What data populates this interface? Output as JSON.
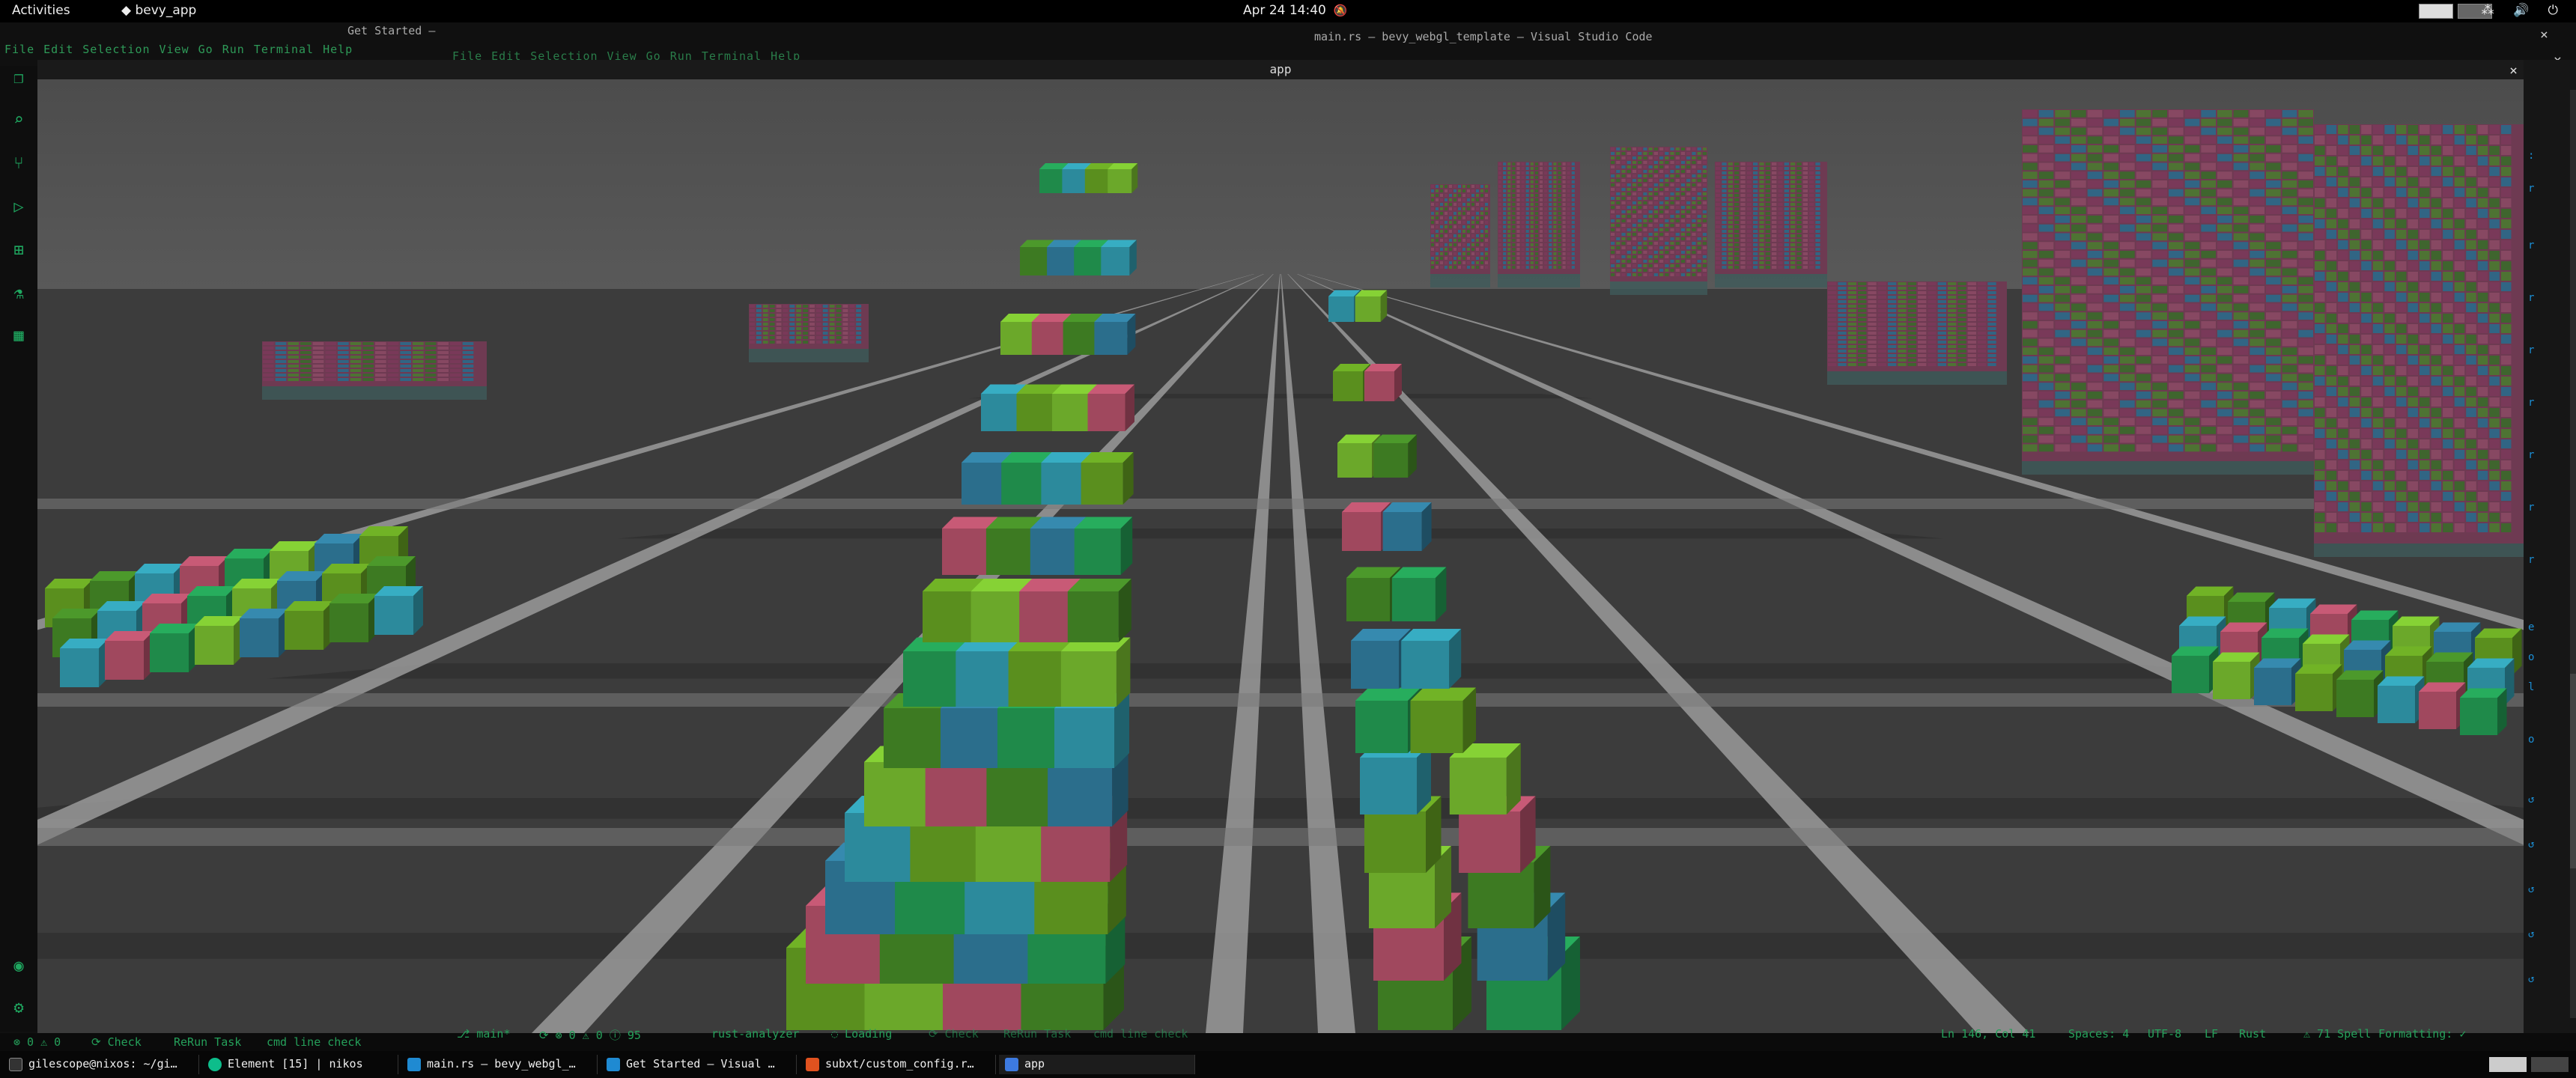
{
  "topbar": {
    "activities": "Activities",
    "app_menu": "◆ bevy_app",
    "clock": "Apr 24 14:40",
    "tray": "⁂ 🔊 ⏻"
  },
  "vscode_back": {
    "get_started": "Get Started —",
    "menu": [
      "File",
      "Edit",
      "Selection",
      "View",
      "Go",
      "Run",
      "Terminal",
      "Help"
    ]
  },
  "vscode_front": {
    "title": "main.rs — bevy_webgl_template — Visual Studio Code",
    "menu": [
      "File",
      "Edit",
      "Selection",
      "View",
      "Go",
      "Run",
      "Terminal",
      "Help"
    ]
  },
  "app": {
    "title": "app",
    "close": "×"
  },
  "statusbar": {
    "left_problems": "⊗ 0 ⚠ 0",
    "check": "⟳ Check",
    "rerun": "ReRun Task",
    "cmdline": "cmd line check",
    "branch": "⎇ main*",
    "sync": "⟳ ⊗ 0 ⚠ 0 ⓘ 95",
    "analyzer": "rust-analyzer",
    "loading": "◌ Loading",
    "check2": "⟳ Check",
    "rerun2": "ReRun Task",
    "cmdline2": "cmd line check",
    "position": "Ln 146, Col 41",
    "spaces": "Spaces: 4",
    "encoding": "UTF-8",
    "eol": "LF",
    "language": "Rust",
    "spell": "⚠ 71 Spell",
    "formatting": "Formatting: ✓"
  },
  "taskbar": {
    "tasks": [
      {
        "label": "gilescope@nixos: ~/gi…",
        "color": "#333333"
      },
      {
        "label": "Element [15] | nikos",
        "color": "#0dbd8b"
      },
      {
        "label": "main.rs — bevy_webgl_…",
        "color": "#1f8ad2"
      },
      {
        "label": "Get Started — Visual …",
        "color": "#1f8ad2"
      },
      {
        "label": "subxt/custom_config.r…",
        "color": "#e0521f"
      },
      {
        "label": "app",
        "color": "#3d7ae0"
      }
    ]
  },
  "scene": {
    "sky": "#4a4a4a",
    "ground": "#3a3a3a",
    "road": "#9a9a9a",
    "tile": "#2e2e2e",
    "cube_colors": [
      "#5a8f1e",
      "#3d7a22",
      "#2c8a9c",
      "#a0485e",
      "#1f8a4a",
      "#6ba82a",
      "#2b6e8c"
    ]
  },
  "icons": {
    "activitybar": [
      "explorer-icon",
      "search-icon",
      "source-control-icon",
      "run-debug-icon",
      "extensions-icon",
      "testing-icon",
      "remote-icon",
      "account-icon",
      "settings-gear-icon"
    ]
  }
}
